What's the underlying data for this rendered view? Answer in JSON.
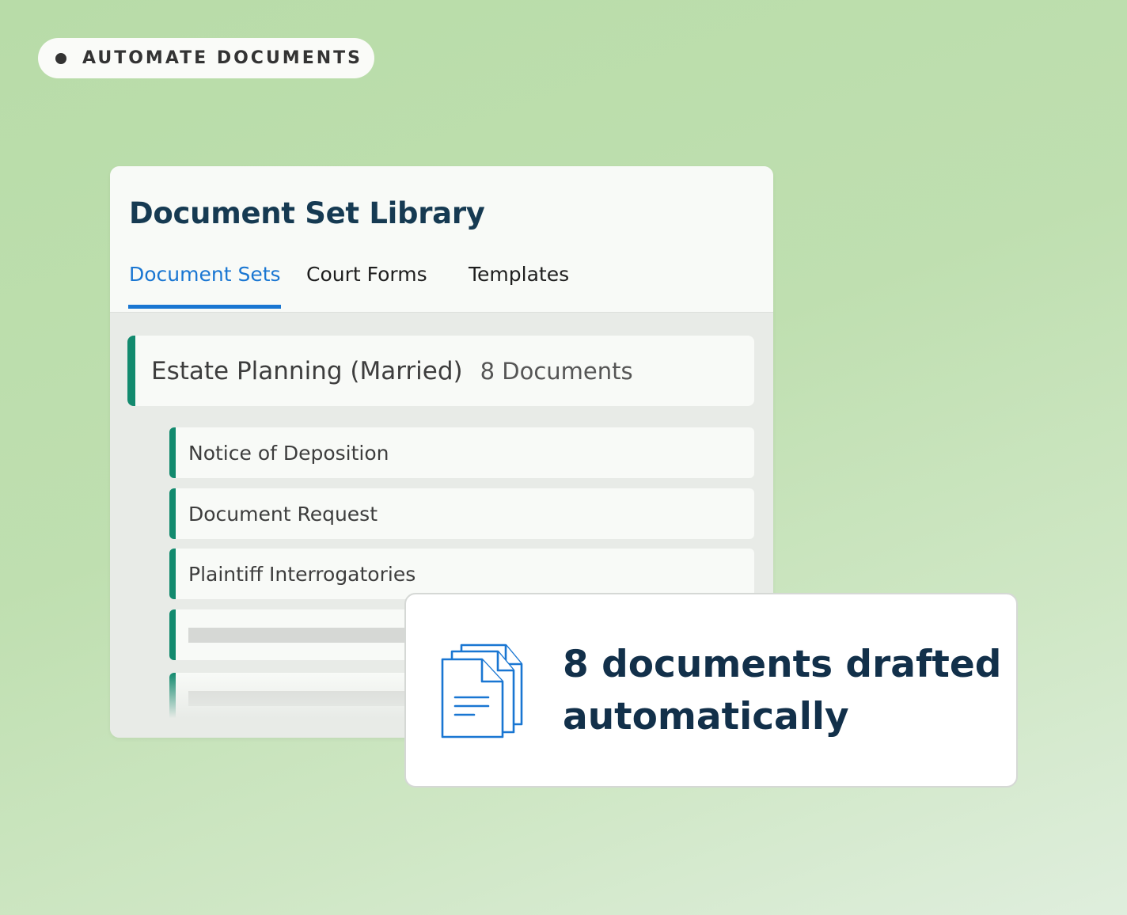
{
  "badge": {
    "label": "AUTOMATE DOCUMENTS"
  },
  "library": {
    "title": "Document Set Library",
    "tabs": [
      {
        "label": "Document Sets",
        "active": true
      },
      {
        "label": "Court Forms",
        "active": false
      },
      {
        "label": "Templates",
        "active": false
      }
    ],
    "set": {
      "name": "Estate Planning (Married)",
      "count": "8 Documents"
    },
    "documents": [
      {
        "label": "Notice of Deposition"
      },
      {
        "label": "Document Request"
      },
      {
        "label": "Plaintiff Interrogatories"
      }
    ]
  },
  "notice": {
    "text": "8 documents drafted automatically",
    "icon": "documents-stack-icon"
  },
  "colors": {
    "accent_blue": "#1976d2",
    "accent_green": "#128a6e",
    "title_navy": "#163a52"
  }
}
